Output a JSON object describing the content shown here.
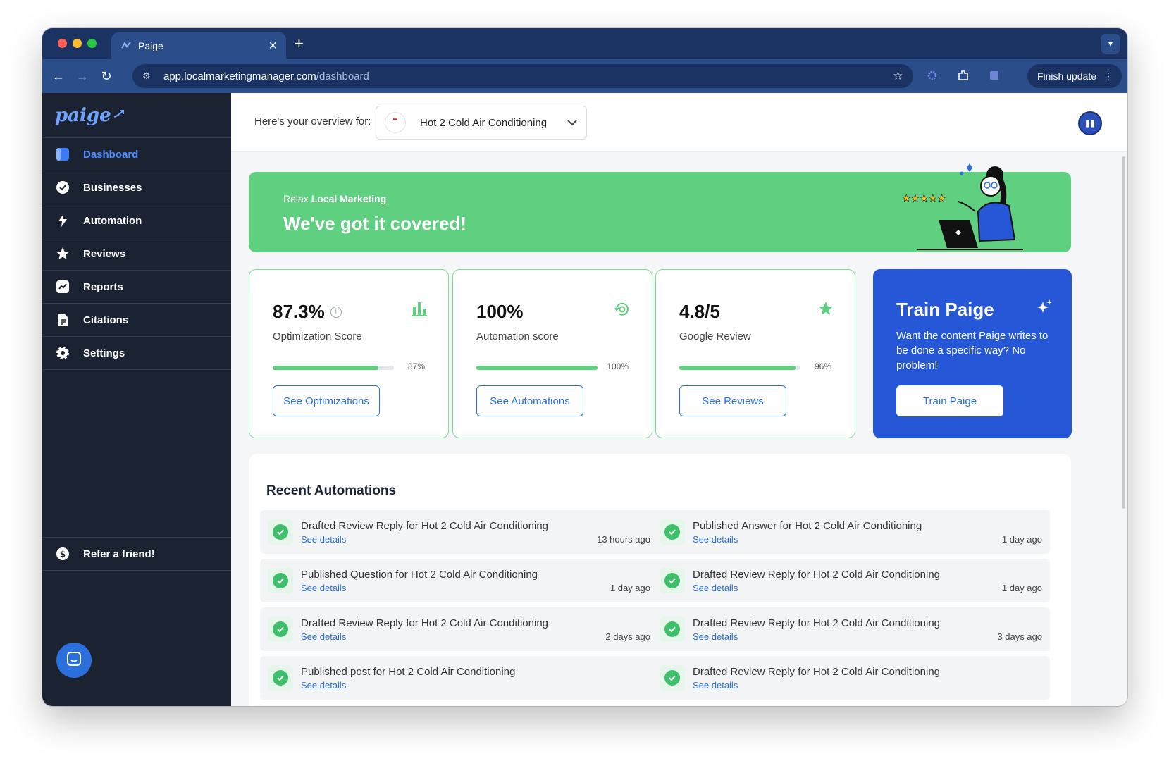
{
  "browser": {
    "tab_title": "Paige",
    "url_host": "app.localmarketingmanager.com",
    "url_path": "/dashboard",
    "finish_update": "Finish update"
  },
  "sidebar": {
    "logo": "paige",
    "items": [
      {
        "label": "Dashboard",
        "icon": "dashboard-icon",
        "active": true
      },
      {
        "label": "Businesses",
        "icon": "badge-check-icon"
      },
      {
        "label": "Automation",
        "icon": "bolt-icon"
      },
      {
        "label": "Reviews",
        "icon": "star-icon"
      },
      {
        "label": "Reports",
        "icon": "chart-line-icon"
      },
      {
        "label": "Citations",
        "icon": "document-icon"
      },
      {
        "label": "Settings",
        "icon": "gear-icon"
      }
    ],
    "refer": "Refer a friend!"
  },
  "topbar": {
    "overview_label": "Here's your overview for:",
    "business": "Hot 2 Cold Air Conditioning"
  },
  "banner": {
    "sub_plain": "Relax ",
    "sub_bold": "Local Marketing",
    "title": "We've got it covered!"
  },
  "cards": [
    {
      "value": "87.3%",
      "label": "Optimization Score",
      "percent": 87,
      "percent_label": "87%",
      "button": "See Optimizations",
      "icon": "bar-chart-icon"
    },
    {
      "value": "100%",
      "label": "Automation score",
      "percent": 100,
      "percent_label": "100%",
      "button": "See Automations",
      "icon": "refresh-gear-icon"
    },
    {
      "value": "4.8/5",
      "label": "Google Review",
      "percent": 96,
      "percent_label": "96%",
      "button": "See Reviews",
      "icon": "star-icon"
    }
  ],
  "train": {
    "title": "Train Paige",
    "desc": "Want the content Paige writes to be done a specific way? No problem!",
    "button": "Train Paige"
  },
  "recent": {
    "title": "Recent Automations",
    "link_label": "See details",
    "items": [
      {
        "title": "Drafted Review Reply for Hot 2 Cold Air Conditioning",
        "time": "13 hours ago"
      },
      {
        "title": "Published Answer for Hot 2 Cold Air Conditioning",
        "time": "1 day ago"
      },
      {
        "title": "Published Question for Hot 2 Cold Air Conditioning",
        "time": "1 day ago"
      },
      {
        "title": "Drafted Review Reply for Hot 2 Cold Air Conditioning",
        "time": "1 day ago"
      },
      {
        "title": "Drafted Review Reply for Hot 2 Cold Air Conditioning",
        "time": "2 days ago"
      },
      {
        "title": "Drafted Review Reply for Hot 2 Cold Air Conditioning",
        "time": "3 days ago"
      },
      {
        "title": "Published post for Hot 2 Cold Air Conditioning",
        "time": ""
      },
      {
        "title": "Drafted Review Reply for Hot 2 Cold Air Conditioning",
        "time": ""
      }
    ]
  },
  "colors": {
    "accent": "#2a6fdb",
    "green": "#5fcf80",
    "sidebar_bg": "#1b2333",
    "train_bg": "#2557d6"
  }
}
